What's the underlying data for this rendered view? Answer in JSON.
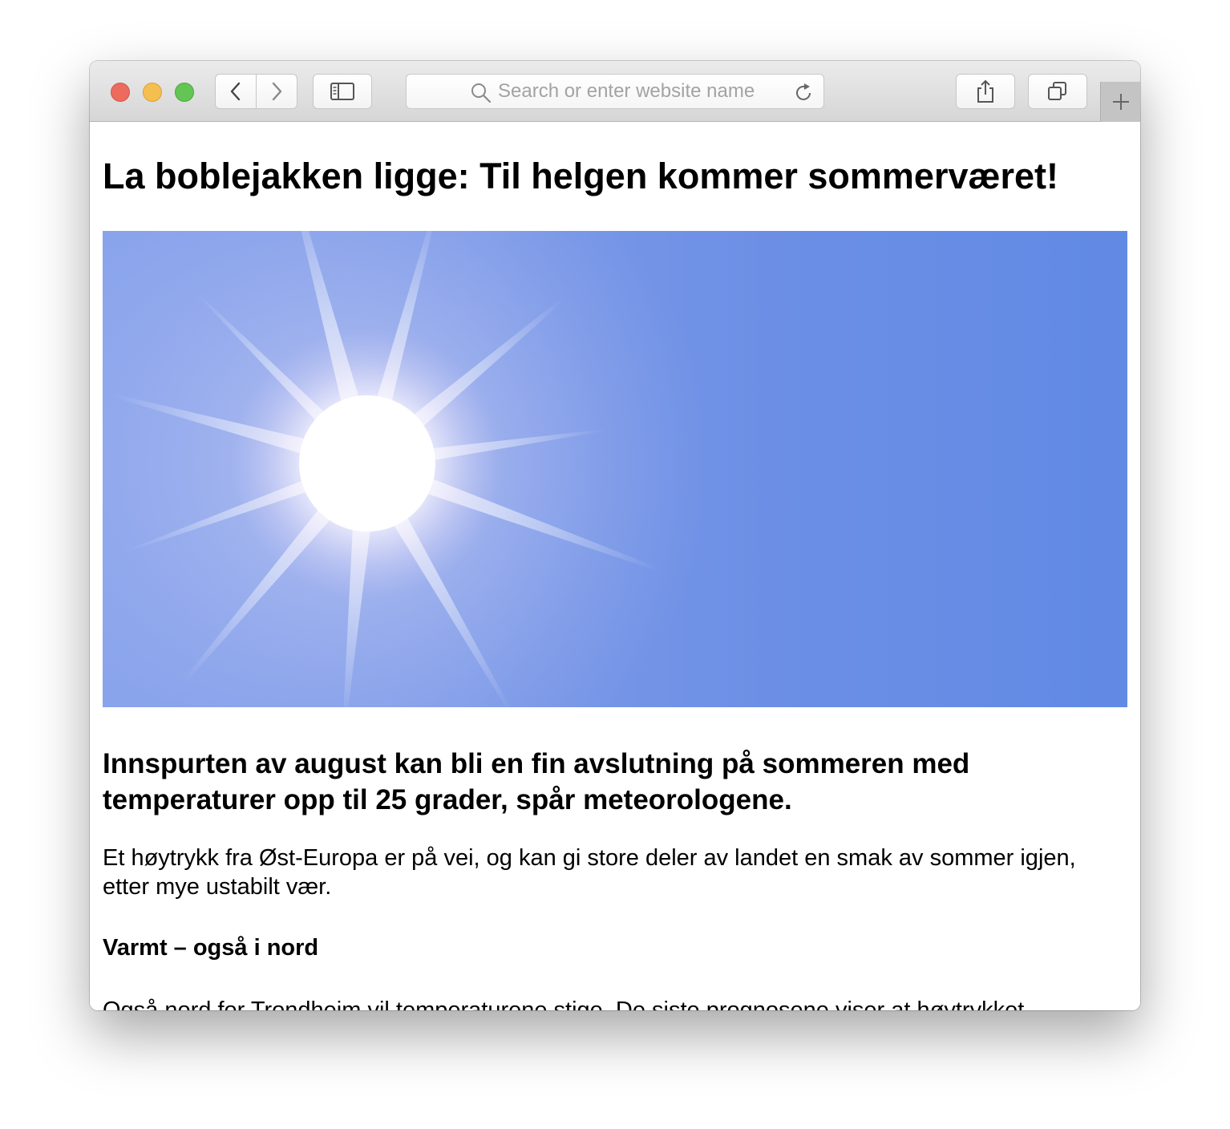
{
  "browser": {
    "search_placeholder": "Search or enter website name",
    "buttons": {
      "back": "chevron-left-icon",
      "forward": "chevron-right-icon",
      "sidebar": "sidebar-icon",
      "share": "share-icon",
      "tabs": "tabs-icon",
      "new_tab": "plus-icon"
    }
  },
  "article": {
    "title": "La boblejakken ligge: Til helgen kommer sommerværet!",
    "hero_image": "sun-in-blue-sky",
    "lead": "Innspurten av august kan bli en fin avslutning på sommeren med temperaturer opp til 25 grader, spår meteorologene.",
    "paragraph1": "Et høytrykk fra Øst-Europa er på vei, og kan gi store deler av landet en smak av sommer igjen, etter mye ustabilt vær.",
    "subheading": "Varmt – også i nord",
    "paragraph2": "Også nord for Trondheim vil temperaturene stige. De siste prognosene viser at høytrykket"
  },
  "colors": {
    "traffic_red": "#ed6a5e",
    "traffic_yellow": "#f5bf4f",
    "traffic_green": "#62c554",
    "sky_blue": "#618ae5"
  }
}
